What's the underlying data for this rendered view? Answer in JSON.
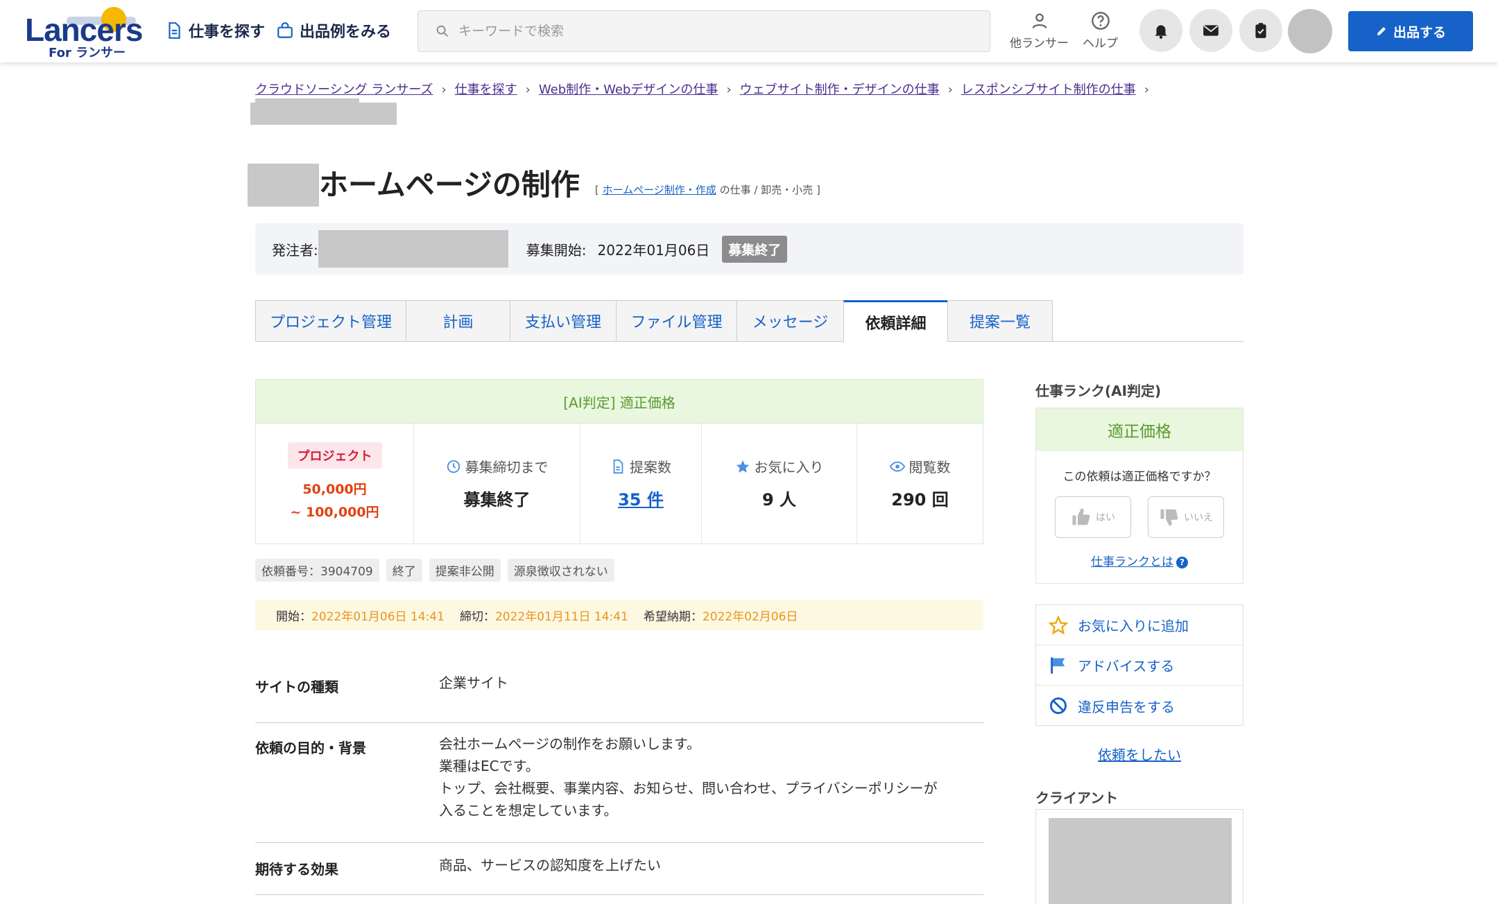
{
  "header": {
    "logo_text": "Lancers",
    "logo_sub": "For ランサー",
    "nav": [
      {
        "label": "仕事を探す",
        "icon": "document-icon"
      },
      {
        "label": "出品例をみる",
        "icon": "shopping-bag-icon"
      }
    ],
    "search_placeholder": "キーワードで検索",
    "other_lancer_label": "他ランサー",
    "help_label": "ヘルプ",
    "post_button_label": "出品する",
    "accent": "#1662c8"
  },
  "breadcrumb": [
    "クラウドソーシング ランサーズ",
    "仕事を探す",
    "Web制作・Webデザインの仕事",
    "ウェブサイト制作・デザインの仕事",
    "レスポンシブサイト制作の仕事"
  ],
  "job": {
    "title": "ホームページの制作",
    "category_prefix": "[",
    "category_link": "ホームページ制作・作成",
    "category_suffix": "の仕事 / 卸売・小売 ]",
    "client_label": "発注者:",
    "start_label": "募集開始:",
    "start_date": "2022年01月06日",
    "status_badge": "募集終了"
  },
  "tabs": [
    {
      "label": "プロジェクト管理",
      "active": false
    },
    {
      "label": "計画",
      "active": false
    },
    {
      "label": "支払い管理",
      "active": false
    },
    {
      "label": "ファイル管理",
      "active": false
    },
    {
      "label": "メッセージ",
      "active": false
    },
    {
      "label": "依頼詳細",
      "active": true
    },
    {
      "label": "提案一覧",
      "active": false
    }
  ],
  "ai_banner": "[AI判定] 適正価格",
  "stats": {
    "project_badge": "プロジェクト",
    "price_min": "50,000円",
    "price_max": "~ 100,000円",
    "deadline_label": "募集締切まで",
    "deadline_value": "募集終了",
    "proposals_label": "提案数",
    "proposals_value": "35 件",
    "favorites_label": "お気に入り",
    "favorites_value": "9 人",
    "views_label": "閲覧数",
    "views_value": "290 回"
  },
  "tags": [
    "依頼番号：3904709",
    "終了",
    "提案非公開",
    "源泉徴収されない"
  ],
  "dates": {
    "start_label": "開始：",
    "start_value": "2022年01月06日 14:41",
    "end_label": "締切：",
    "end_value": "2022年01月11日 14:41",
    "delivery_label": "希望納期：",
    "delivery_value": "2022年02月06日"
  },
  "details": [
    {
      "key": "サイトの種類",
      "lines": [
        "企業サイト"
      ]
    },
    {
      "key": "依頼の目的・背景",
      "lines": [
        "会社ホームページの制作をお願いします。",
        "業種はECです。",
        "トップ、会社概要、事業内容、お知らせ、問い合わせ、プライバシーポリシーが",
        "入ることを想定しています。"
      ]
    },
    {
      "key": "期待する効果",
      "lines": [
        "商品、サービスの認知度を上げたい"
      ]
    }
  ],
  "sidebar": {
    "rank_heading": "仕事ランク(AI判定)",
    "rank_value": "適正価格",
    "rank_question": "この依頼は適正価格ですか？",
    "yes_label": "はい",
    "no_label": "いいえ",
    "rank_link": "仕事ランクとは",
    "actions": [
      {
        "label": "お気に入りに追加",
        "icon": "star-outline-icon"
      },
      {
        "label": "アドバイスする",
        "icon": "flag-icon"
      },
      {
        "label": "違反申告をする",
        "icon": "prohibited-icon"
      }
    ],
    "order_link": "依頼をしたい",
    "client_heading": "クライアント"
  }
}
